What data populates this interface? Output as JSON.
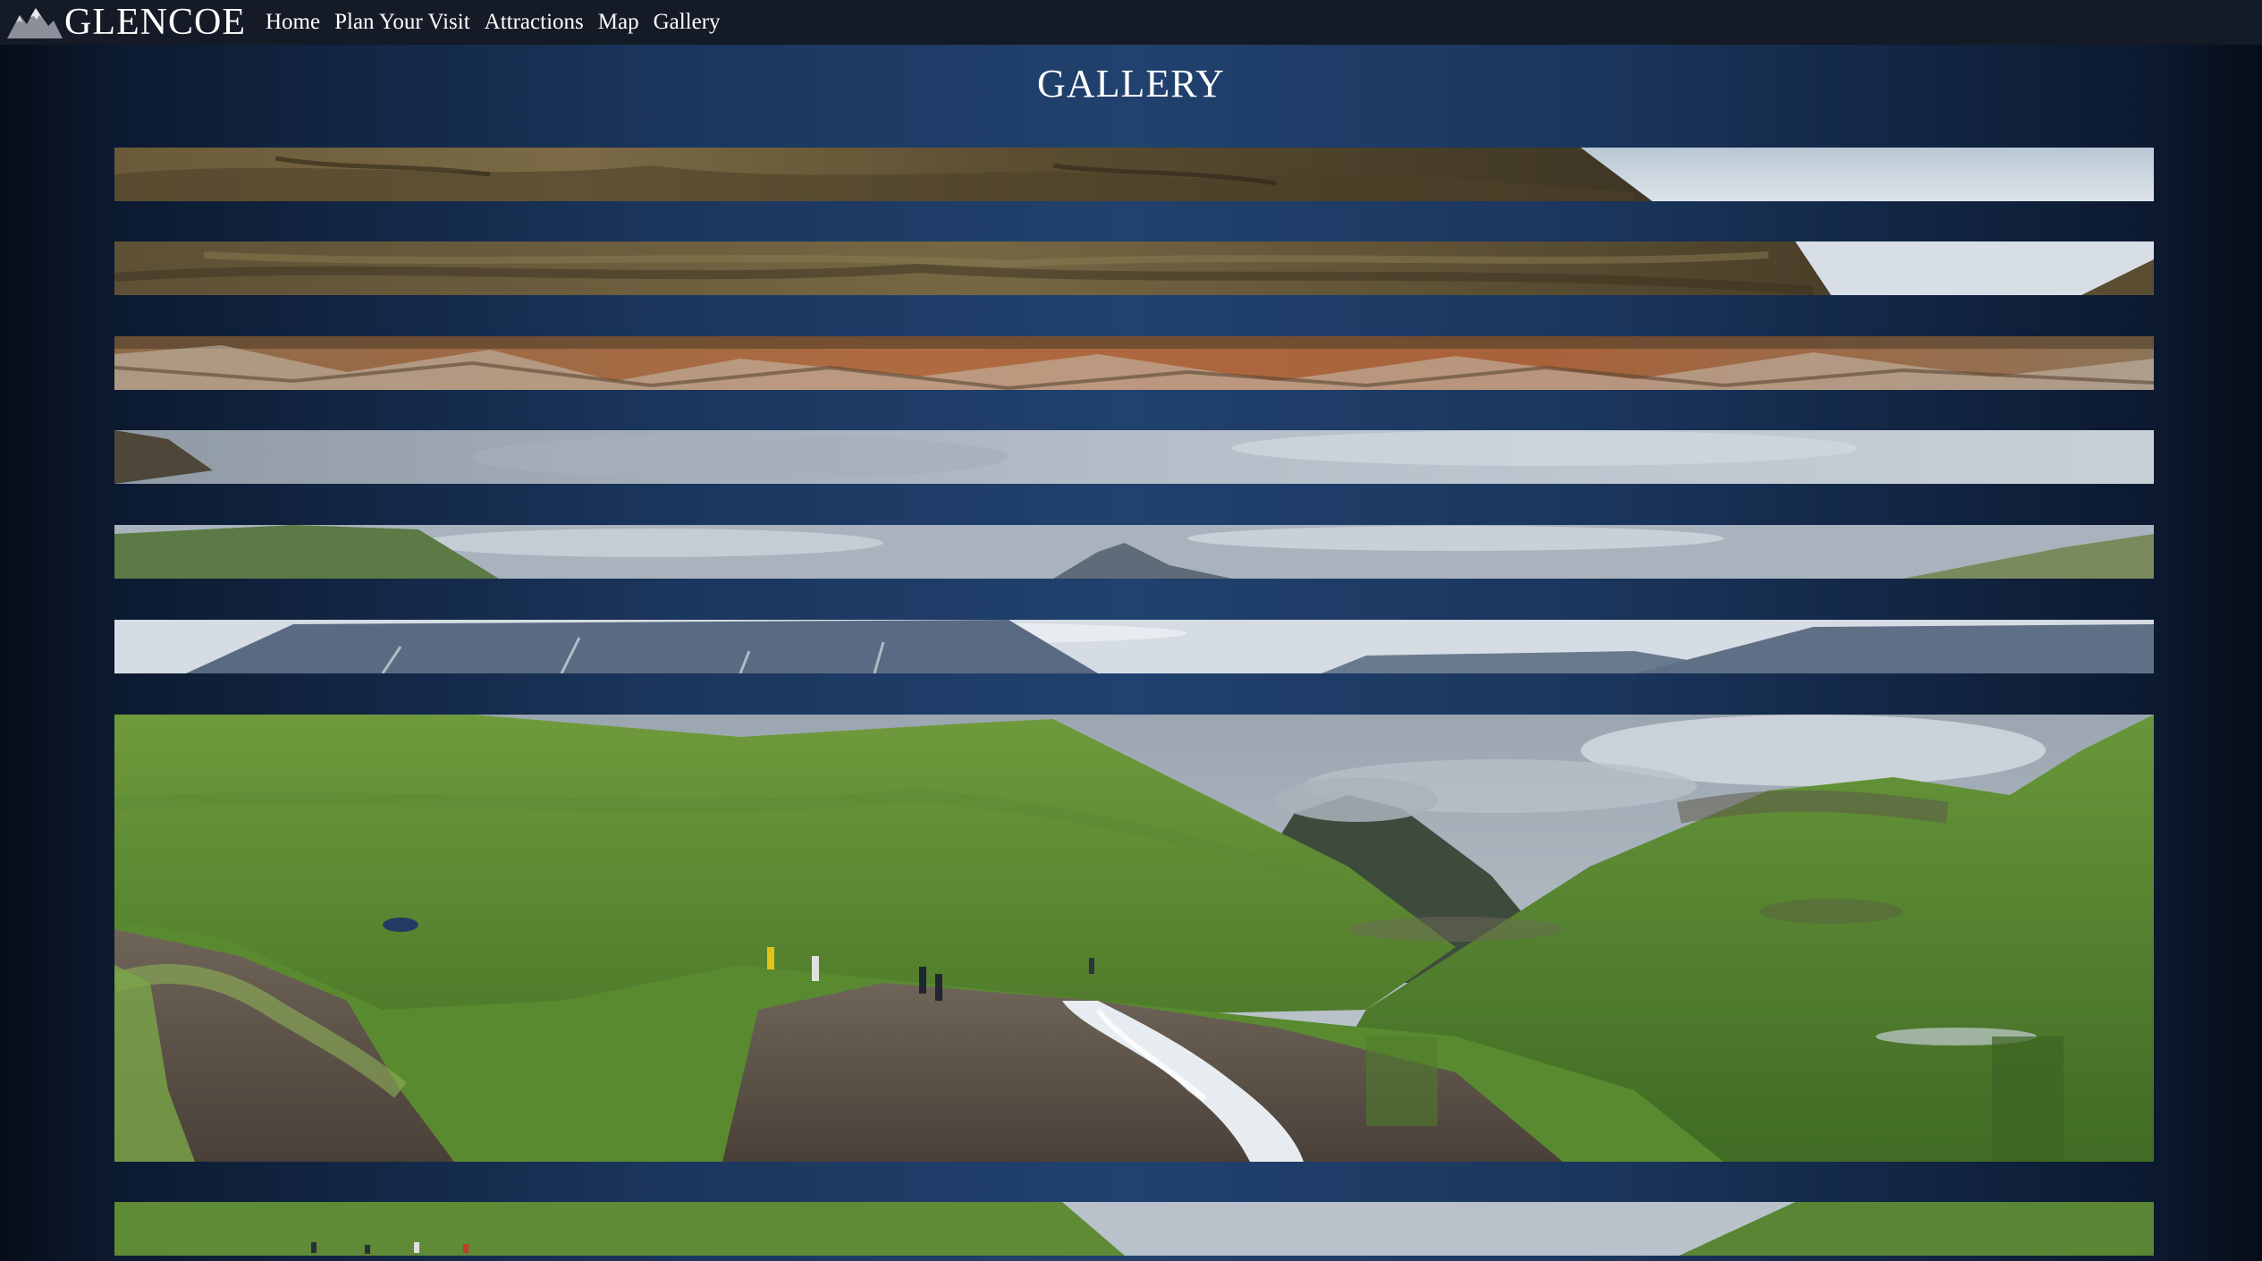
{
  "nav": {
    "brand": "GLENCOE",
    "logo_icon": "mountain-logo-icon",
    "links": [
      "Home",
      "Plan Your Visit",
      "Attractions",
      "Map",
      "Gallery"
    ]
  },
  "page": {
    "title": "GALLERY"
  },
  "colors": {
    "navbar": "#141a26",
    "page_center": "#21416e",
    "page_edge": "#070d18",
    "text": "#ffffff"
  }
}
